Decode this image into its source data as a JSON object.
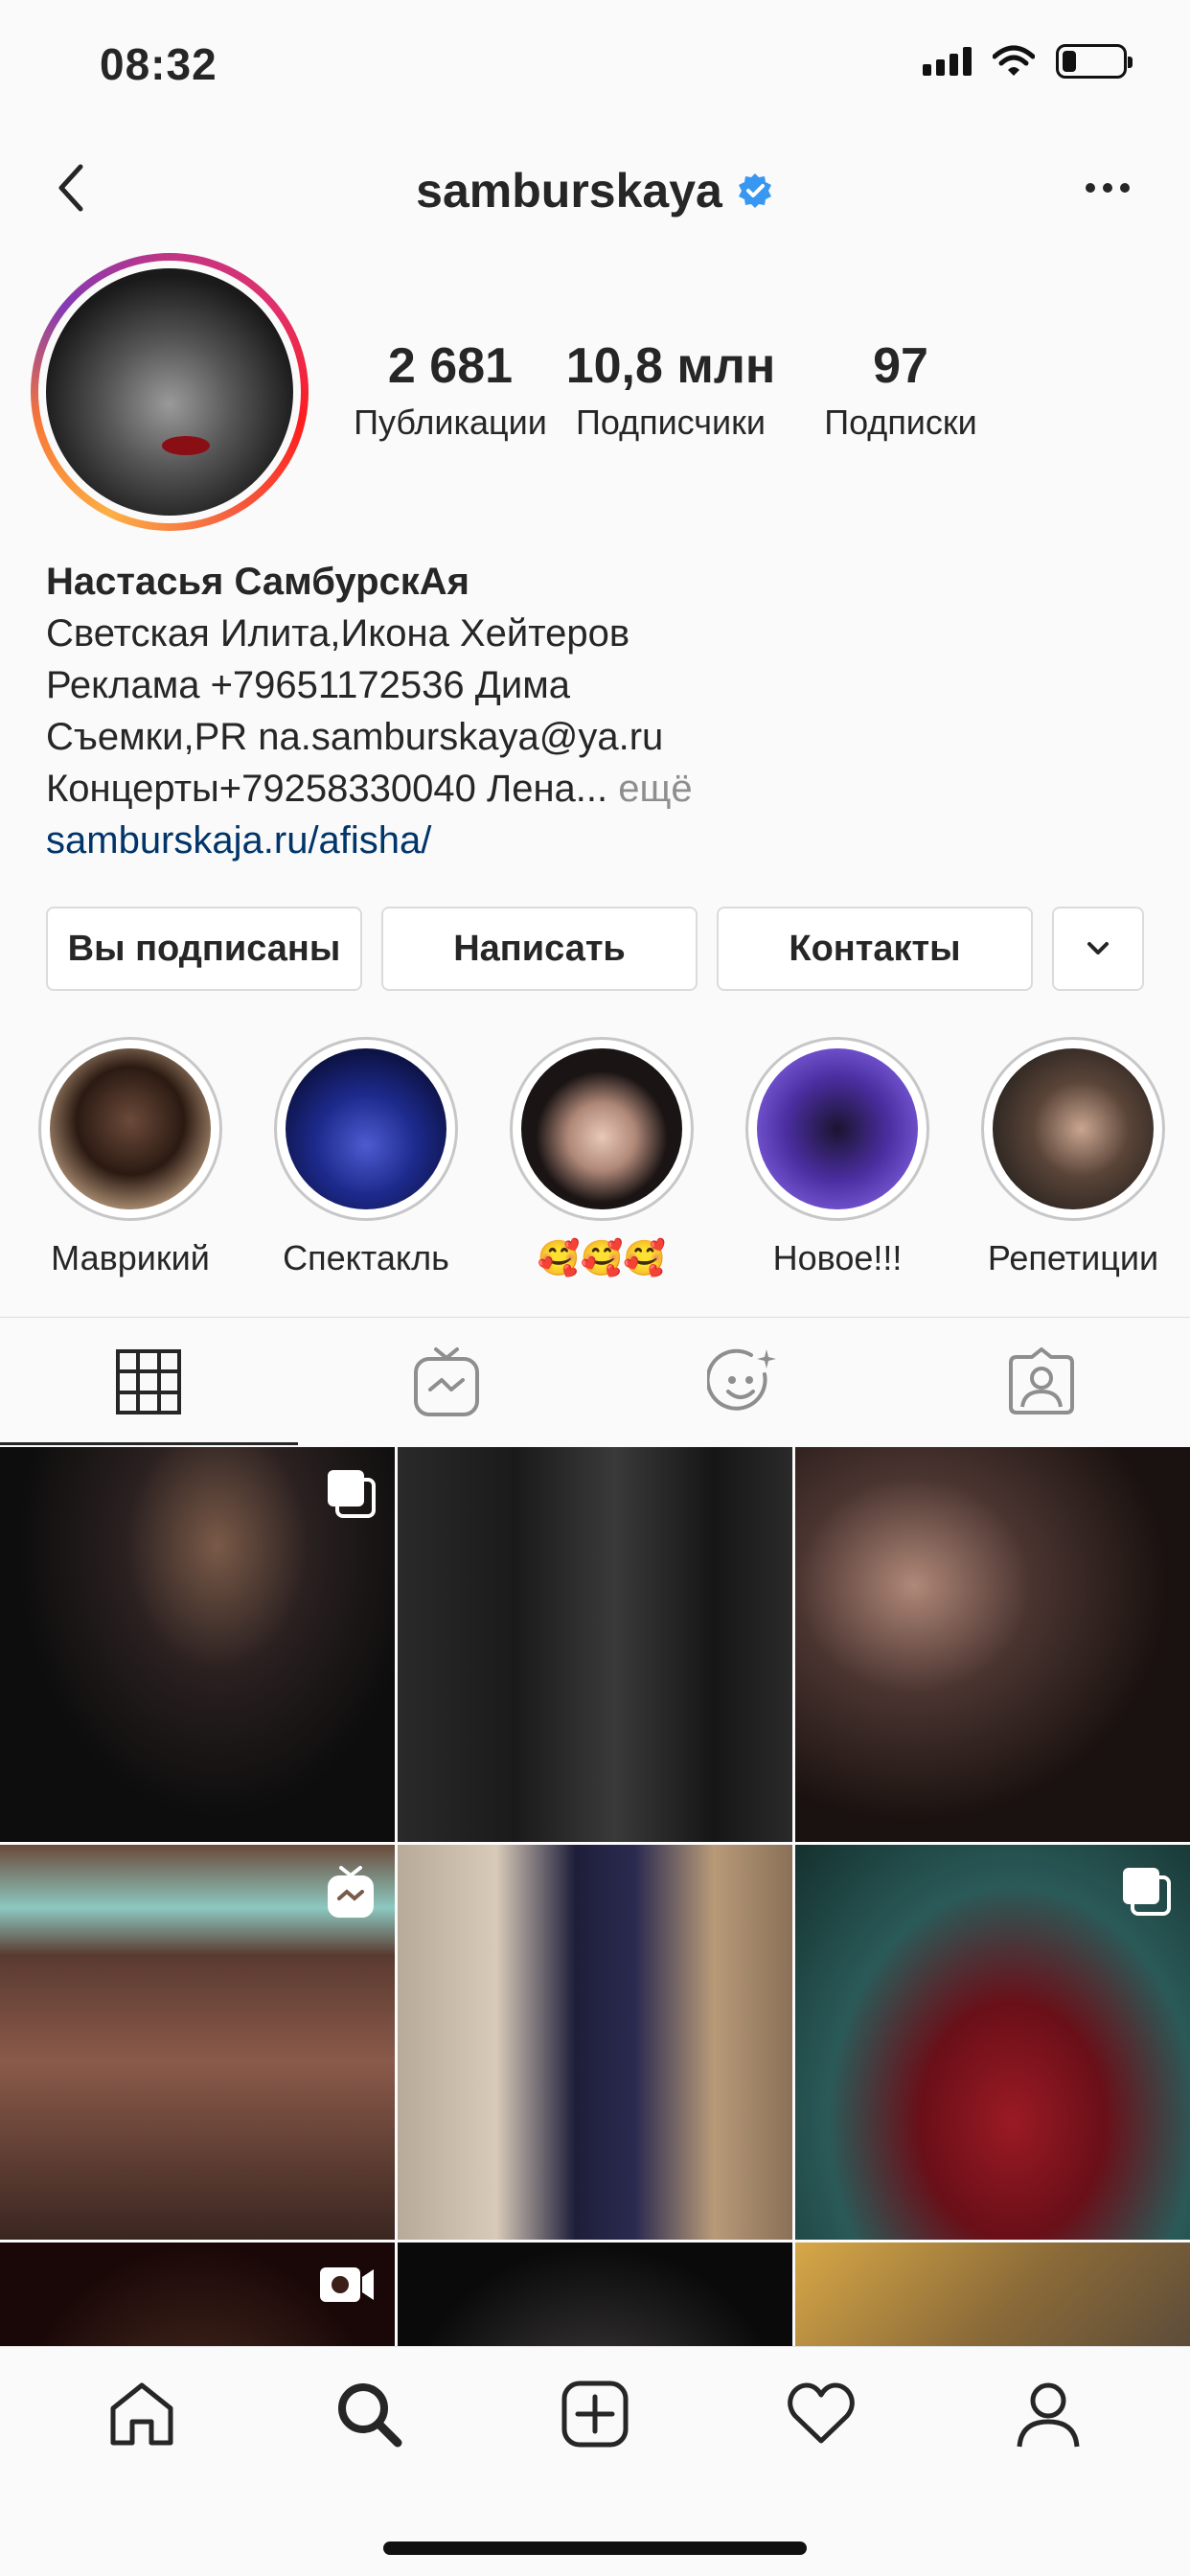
{
  "status": {
    "time": "08:32"
  },
  "header": {
    "username": "samburskaya"
  },
  "stats": [
    {
      "num": "2 681",
      "label": "Публикации"
    },
    {
      "num": "10,8 млн",
      "label": "Подписчики"
    },
    {
      "num": "97",
      "label": "Подписки"
    }
  ],
  "bio": {
    "name": "Настасья СамбурскАя",
    "line1": "Светская Илита,Икона Хейтеров",
    "line2": "Реклама +79651172536 Дима",
    "line3": "Съемки,PR na.samburskaya@ya.ru",
    "line4": "Концерты+79258330040 Лена...",
    "more": "ещё",
    "link": "samburskaja.ru/afisha/"
  },
  "actions": {
    "following": "Вы подписаны",
    "message": "Написать",
    "contacts": "Контакты"
  },
  "highlights": [
    {
      "label": "Маврикий"
    },
    {
      "label": "Спектакль"
    },
    {
      "label": "🥰🥰🥰"
    },
    {
      "label": "Новое!!!"
    },
    {
      "label": "Репетиции"
    }
  ],
  "tabs": [
    "grid-icon",
    "igtv-icon",
    "reels-effects-icon",
    "tagged-icon"
  ],
  "colors": {
    "verified": "#3897f0",
    "link": "#003569",
    "muted": "#8e8e8e"
  }
}
